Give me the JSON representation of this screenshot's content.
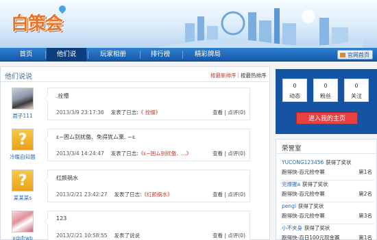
{
  "header": {
    "logo_text": "白策会"
  },
  "nav": {
    "items": [
      {
        "label": "首页"
      },
      {
        "label": "他们说"
      },
      {
        "label": "玩家相册"
      },
      {
        "label": "排行榜"
      },
      {
        "label": "精彩牌局"
      }
    ],
    "official_label": "官网首页"
  },
  "main": {
    "title": "他们说说",
    "sort_new": "按最新排序",
    "sort_sep": "|",
    "sort_hot": "按最热排序",
    "posts": [
      {
        "user": "聂子111",
        "content": ".拴懵",
        "time": "2013/3/9 23:17:36",
        "action": "发表了日志:",
        "link": "《 拴懵》",
        "view": "查看",
        "sep": "|",
        "comment": "点评(0)"
      },
      {
        "user": "冷暖自知菌",
        "content": "ε~困ム别扰傲、免得犹ム栗. ~ε",
        "time": "2013/3/4 14:24:47",
        "action": "发表了日志:",
        "link": "《ε~困ム别扰傲、...》",
        "view": "查看",
        "sep": "|",
        "comment": "点评(0)"
      },
      {
        "user": "某某某s",
        "content": "红颜祸水",
        "time": "2013/2/21 23:42:27",
        "action": "发表了日志:",
        "link": "《红颜祸水》",
        "view": "查看",
        "sep": "|",
        "comment": "点评(0)"
      },
      {
        "user": "xdsfrwb",
        "content": "123",
        "time": "2013/2/21 10:58:55",
        "action": "发表了说说",
        "link": "",
        "view": "查看",
        "sep": "|",
        "comment": "点评(0)"
      }
    ]
  },
  "profile": {
    "stats": [
      {
        "value": "0",
        "label": "动态"
      },
      {
        "value": "0",
        "label": "粉丝"
      },
      {
        "value": "0",
        "label": "关注"
      }
    ],
    "home_button": "进入我的主页"
  },
  "honor": {
    "title": "荣誉室",
    "items": [
      {
        "name": "YUCONG123456",
        "text": "获得了奖状",
        "game": "跑得快-百元抢夺赛",
        "rank": "第1名"
      },
      {
        "name": "完爆猩a",
        "text": "获得了奖状",
        "game": "跑得快-百元抢夺赛",
        "rank": "第2名"
      },
      {
        "name": "pengl",
        "text": "获得了奖状",
        "game": "跑得快-百元抢夺赛",
        "rank": "第3名"
      },
      {
        "name": "小不夹身",
        "text": "获得了奖状",
        "game": "跑得快-百日100元现金赛",
        "rank": "第1名"
      }
    ]
  },
  "colors": {
    "nav_blue": "#1659a8",
    "profile_blue": "#1454a2",
    "accent_red": "#e94040",
    "link_red": "#c0392b",
    "logo_orange": "#e8742a"
  }
}
